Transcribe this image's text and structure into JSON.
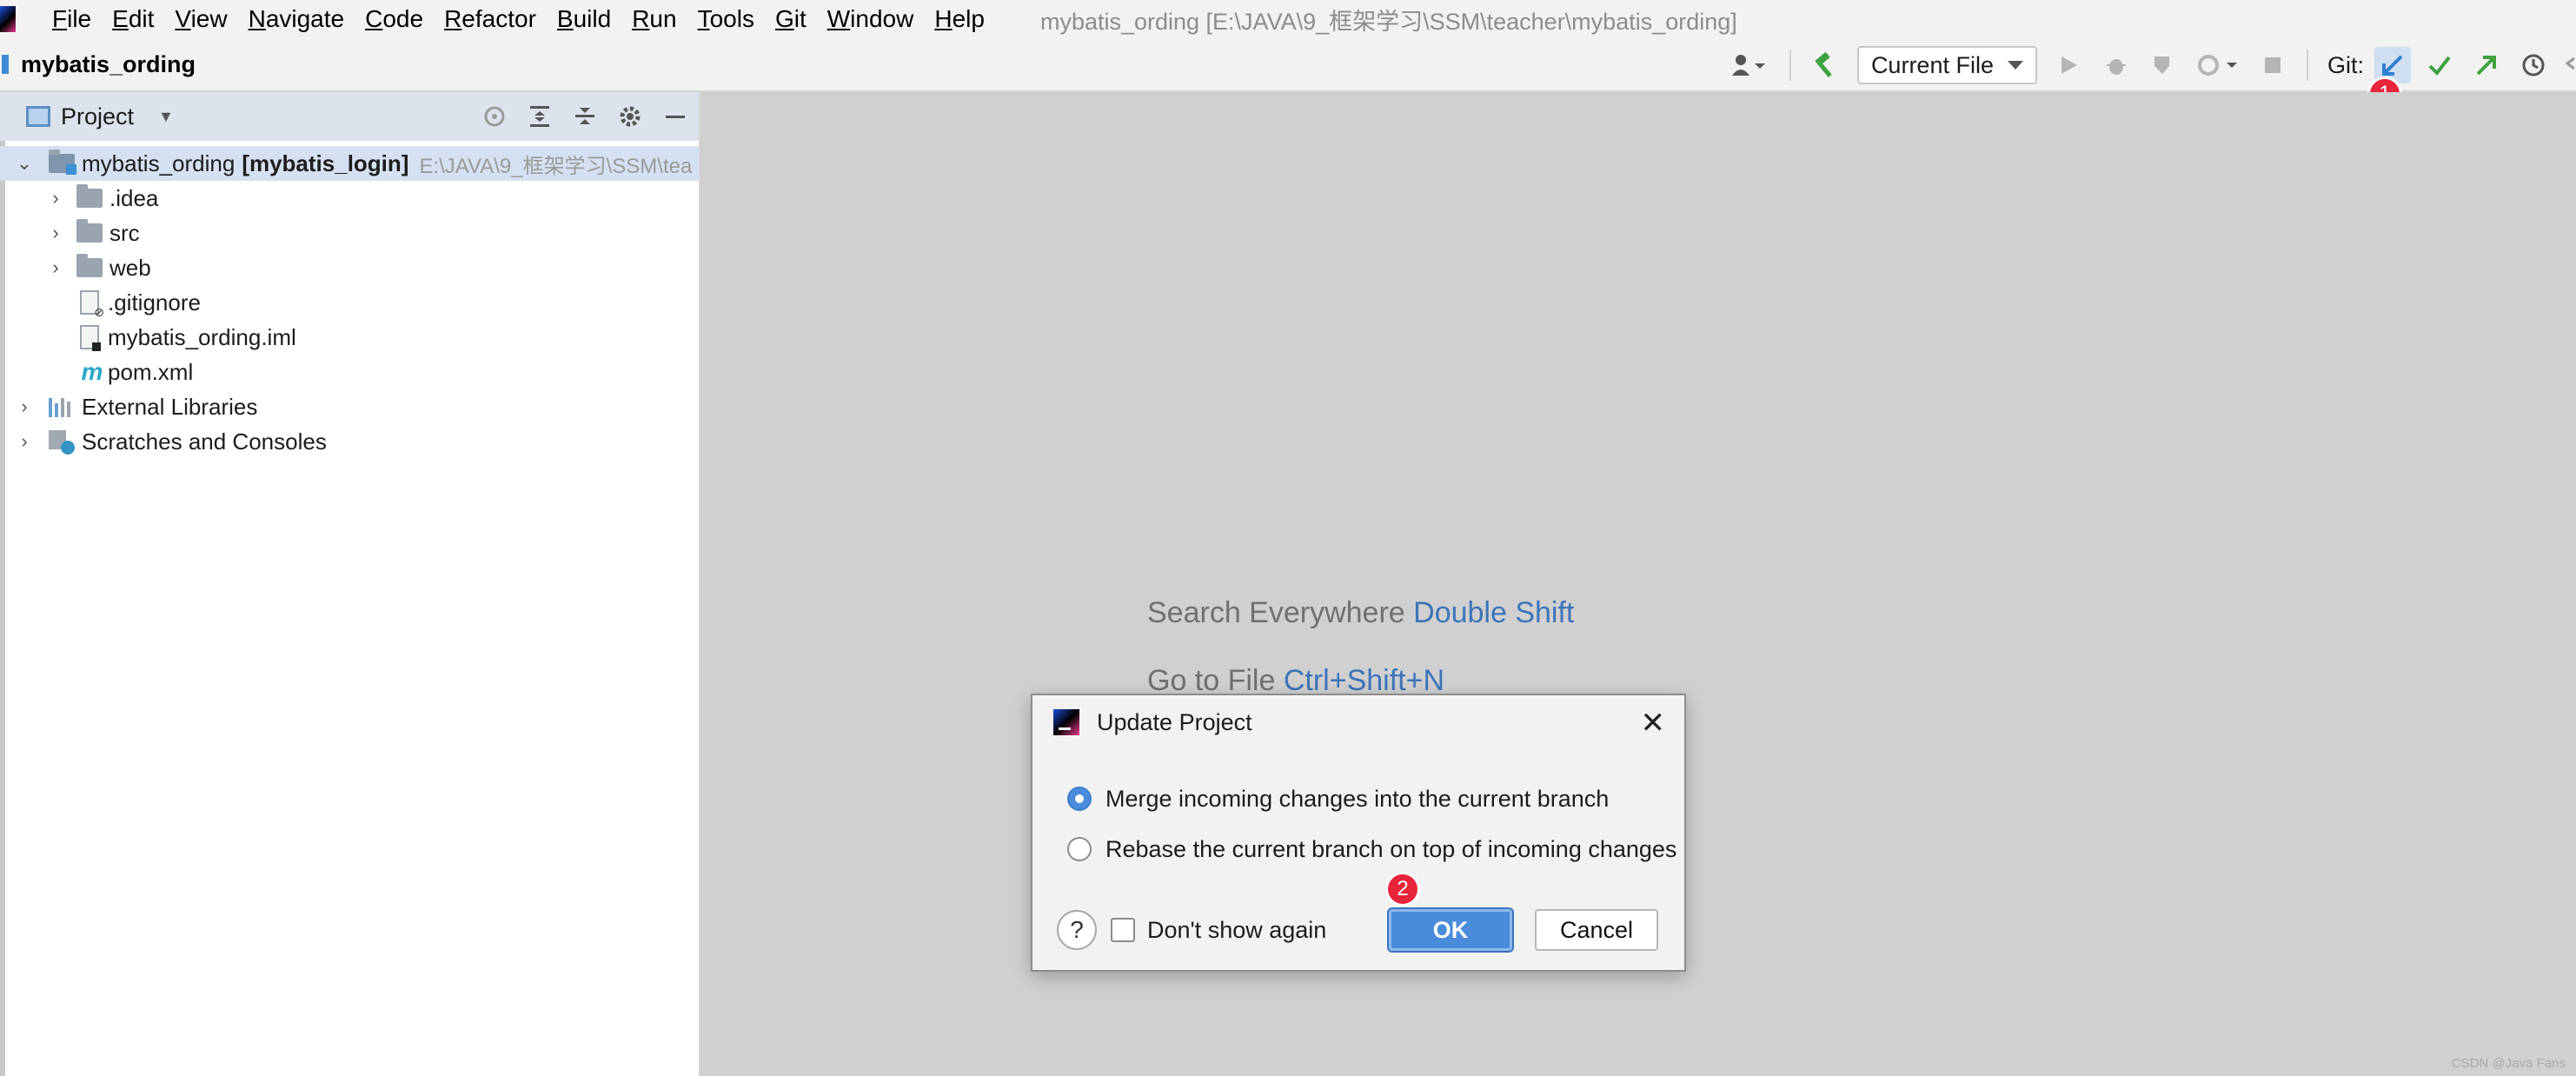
{
  "menu": {
    "items": [
      {
        "mnemonic": "F",
        "rest": "ile"
      },
      {
        "mnemonic": "E",
        "rest": "dit"
      },
      {
        "mnemonic": "V",
        "rest": "iew"
      },
      {
        "mnemonic": "N",
        "rest": "avigate"
      },
      {
        "mnemonic": "C",
        "rest": "ode"
      },
      {
        "mnemonic": "R",
        "rest": "efactor"
      },
      {
        "mnemonic": "B",
        "rest": "uild"
      },
      {
        "mnemonic": "R",
        "rest": "un"
      },
      {
        "mnemonic": "T",
        "rest": "ools"
      },
      {
        "mnemonic": "G",
        "rest": "it"
      },
      {
        "mnemonic": "W",
        "rest": "indow"
      },
      {
        "mnemonic": "H",
        "rest": "elp"
      }
    ],
    "window_title": "mybatis_ording [E:\\JAVA\\9_框架学习\\SSM\\teacher\\mybatis_ording]"
  },
  "navbar": {
    "project_name": "mybatis_ording",
    "run_config": "Current File",
    "git_label": "Git:"
  },
  "annotations": {
    "badge_1": "1",
    "badge_2": "2"
  },
  "project_pane": {
    "title": "Project",
    "tree": {
      "root_name": "mybatis_ording",
      "root_module": "[mybatis_login]",
      "root_path": "E:\\JAVA\\9_框架学习\\SSM\\tea",
      "items": [
        ".idea",
        "src",
        "web",
        ".gitignore",
        "mybatis_ording.iml",
        "pom.xml"
      ],
      "external_libraries": "External Libraries",
      "scratches": "Scratches and Consoles"
    }
  },
  "editor": {
    "hint_search_label": "Search Everywhere",
    "hint_search_key": "Double Shift",
    "hint_goto_label": "Go to File",
    "hint_goto_key": "Ctrl+Shift+N",
    "watermark": "CSDN @Java Fans"
  },
  "dialog": {
    "title": "Update Project",
    "option_merge": "Merge incoming changes into the current branch",
    "option_rebase": "Rebase the current branch on top of incoming changes",
    "help": "?",
    "dont_show": "Don't show again",
    "ok": "OK",
    "cancel": "Cancel"
  },
  "colors": {
    "accent": "#4a8cdb",
    "badge": "#e8243a",
    "editor_bg": "#d0d0d0"
  }
}
